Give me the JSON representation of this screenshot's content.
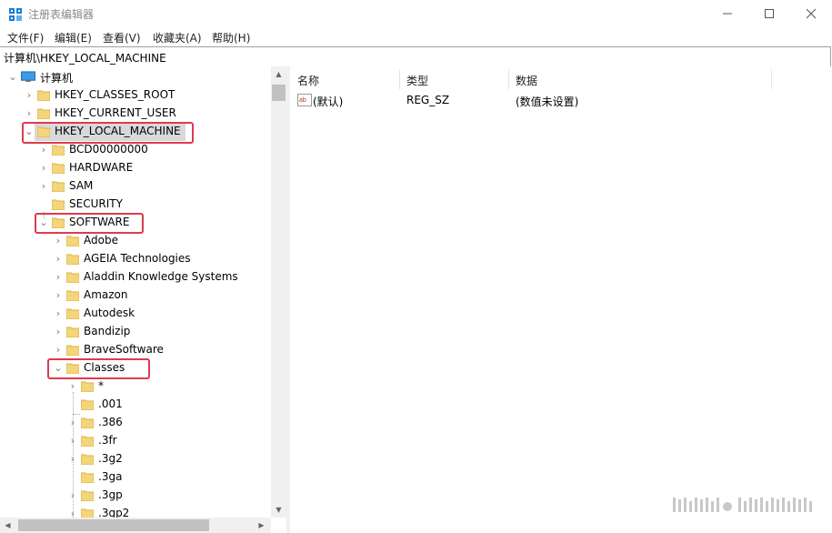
{
  "window": {
    "title": "注册表编辑器"
  },
  "menu": [
    "文件(F)",
    "编辑(E)",
    "查看(V)",
    "收藏夹(A)",
    "帮助(H)"
  ],
  "address": "计算机\\HKEY_LOCAL_MACHINE",
  "tree": {
    "computer": "计算机",
    "hkcr": "HKEY_CLASSES_ROOT",
    "hkcu": "HKEY_CURRENT_USER",
    "hklm": "HKEY_LOCAL_MACHINE",
    "hklm_children": [
      "BCD00000000",
      "HARDWARE",
      "SAM",
      "SECURITY",
      "SOFTWARE"
    ],
    "software_children": [
      "Adobe",
      "AGEIA Technologies",
      "Aladdin Knowledge Systems",
      "Amazon",
      "Autodesk",
      "Bandizip",
      "BraveSoftware",
      "Classes"
    ],
    "classes_children": [
      "*",
      ".001",
      ".386",
      ".3fr",
      ".3g2",
      ".3ga",
      ".3gp",
      ".3gp2"
    ]
  },
  "list": {
    "columns": [
      "名称",
      "类型",
      "数据"
    ],
    "rows": [
      {
        "name": "(默认)",
        "type": "REG_SZ",
        "data": "(数值未设置)"
      }
    ]
  },
  "colors": {
    "highlight_box": "#dd3b4f",
    "folder": "#f4d57a",
    "selected": "#d9d9d9"
  },
  "icons": {
    "app": "registry-editor-icon",
    "folder": "folder-icon",
    "value": "string-value-icon"
  }
}
